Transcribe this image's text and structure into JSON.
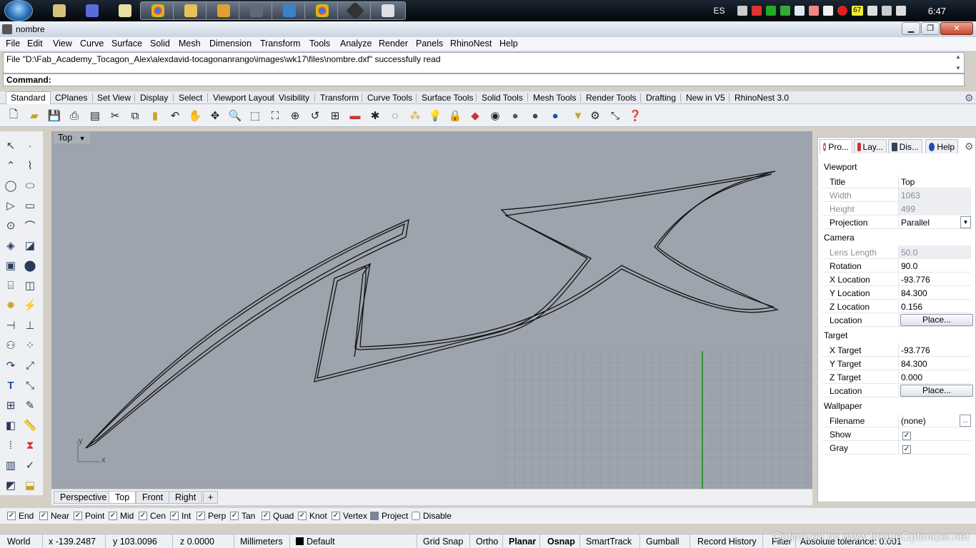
{
  "os": {
    "language": "ES",
    "clock": "6:47",
    "tray_icons": [
      "flag-icon",
      "battery-icon",
      "network-icon",
      "cloud-icon",
      "paw-icon",
      "cloud-icon",
      "mail-icon",
      "counter-icon",
      "device-icon",
      "signal-icon",
      "volume-icon"
    ],
    "tray_counter": "67",
    "taskbar_apps": [
      "inkscape-icon",
      "folder-icon",
      "notepad-icon",
      "chrome-icon",
      "explorer-icon",
      "media-icon",
      "terminal-icon",
      "app-icon",
      "chrome-icon",
      "unity-icon",
      "rhino-icon"
    ]
  },
  "window": {
    "title": "nombre"
  },
  "menu": [
    "File",
    "Edit",
    "View",
    "Curve",
    "Surface",
    "Solid",
    "Mesh",
    "Dimension",
    "Transform",
    "Tools",
    "Analyze",
    "Render",
    "Panels",
    "RhinoNest",
    "Help"
  ],
  "command": {
    "history": "File \"D:\\Fab_Academy_Tocagon_Alex\\alexdavid-tocagonanrango\\images\\wk17\\files\\nombre.dxf\" successfully read",
    "prompt": "Command:"
  },
  "toolbar_tabs": [
    "Standard",
    "CPlanes",
    "Set View",
    "Display",
    "Select",
    "Viewport Layout",
    "Visibility",
    "Transform",
    "Curve Tools",
    "Surface Tools",
    "Solid Tools",
    "Mesh Tools",
    "Render Tools",
    "Drafting",
    "New in V5",
    "RhinoNest 3.0"
  ],
  "viewport": {
    "title": "Top",
    "axis_y": "y",
    "axis_x": "x",
    "tabs": [
      "Perspective",
      "Top",
      "Front",
      "Right"
    ],
    "active_tab": "Top"
  },
  "panel": {
    "tabs": [
      "Pro...",
      "Lay...",
      "Dis...",
      "Help"
    ],
    "viewport_header": "Viewport",
    "title_label": "Title",
    "title_value": "Top",
    "width_label": "Width",
    "width_value": "1063",
    "height_label": "Height",
    "height_value": "499",
    "projection_label": "Projection",
    "projection_value": "Parallel",
    "camera_header": "Camera",
    "lens_label": "Lens Length",
    "lens_value": "50.0",
    "rotation_label": "Rotation",
    "rotation_value": "90.0",
    "xloc_label": "X Location",
    "xloc_value": "-93.776",
    "yloc_label": "Y Location",
    "yloc_value": "84.300",
    "zloc_label": "Z Location",
    "zloc_value": "0.156",
    "location_label": "Location",
    "place_button": "Place...",
    "target_header": "Target",
    "xt_label": "X Target",
    "xt_value": "-93.776",
    "yt_label": "Y Target",
    "yt_value": "84.300",
    "zt_label": "Z Target",
    "zt_value": "0.000",
    "tloc_label": "Location",
    "tplace_button": "Place...",
    "wallpaper_header": "Wallpaper",
    "filename_label": "Filename",
    "filename_value": "(none)",
    "browse_button": "...",
    "show_label": "Show",
    "show_checked": true,
    "gray_label": "Gray",
    "gray_checked": true
  },
  "osnaps": [
    {
      "label": "End",
      "checked": true
    },
    {
      "label": "Near",
      "checked": true
    },
    {
      "label": "Point",
      "checked": true
    },
    {
      "label": "Mid",
      "checked": true
    },
    {
      "label": "Cen",
      "checked": true
    },
    {
      "label": "Int",
      "checked": true
    },
    {
      "label": "Perp",
      "checked": true
    },
    {
      "label": "Tan",
      "checked": true
    },
    {
      "label": "Quad",
      "checked": true
    },
    {
      "label": "Knot",
      "checked": true
    },
    {
      "label": "Vertex",
      "checked": true
    },
    {
      "label": "Project",
      "checked": false
    },
    {
      "label": "Disable",
      "checked": false
    }
  ],
  "status": {
    "cplane": "World",
    "x": "x -139.2487",
    "y": "y 103.0096",
    "z": "z 0.0000",
    "units": "Millimeters",
    "layer": "Default",
    "grid_snap": "Grid Snap",
    "ortho": "Ortho",
    "planar": "Planar",
    "osnap": "Osnap",
    "smarttrack": "SmartTrack",
    "gumball": "Gumball",
    "record_history": "Record History",
    "filter": "Filter",
    "tolerance": "Absolute tolerance: 0.001"
  },
  "watermark": "Optimized by www.ImageOptimizer.net",
  "colors": {
    "viewport_bg": "#9ea4ad",
    "grid": "#8d939c",
    "axis_green": "#2fa02f",
    "curve": "#111111"
  }
}
